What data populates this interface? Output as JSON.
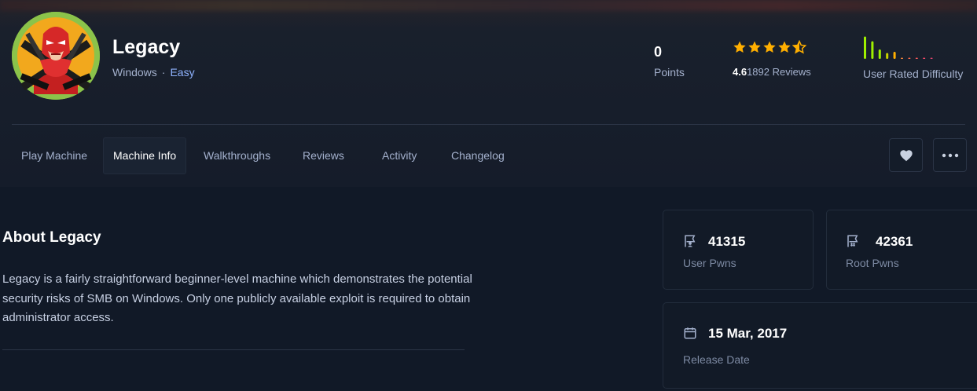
{
  "machine": {
    "name": "Legacy",
    "os": "Windows",
    "separator": "·",
    "difficulty": "Easy"
  },
  "stats": {
    "points_value": "0",
    "points_label": "Points",
    "rating_value": "4.6",
    "reviews_text": "1892 Reviews",
    "star_rating": 4.6,
    "difficulty_label": "User Rated Difficulty",
    "difficulty_bars": [
      0.95,
      0.75,
      0.4,
      0.25,
      0.3,
      0.05,
      0.05,
      0.05,
      0.05,
      0.05
    ]
  },
  "tabs": [
    {
      "label": "Play Machine"
    },
    {
      "label": "Machine Info"
    },
    {
      "label": "Walkthroughs"
    },
    {
      "label": "Reviews"
    },
    {
      "label": "Activity"
    },
    {
      "label": "Changelog"
    }
  ],
  "active_tab": "Machine Info",
  "actions": {
    "favorite_icon": "heart-icon",
    "more_icon": "more-horizontal-icon"
  },
  "about": {
    "title": "About Legacy",
    "text": "Legacy is a fairly straightforward beginner-level machine which demonstrates the potential security risks of SMB on Windows. Only one publicly available exploit is required to obtain administrator access."
  },
  "cards": {
    "user_pwns_value": "41315",
    "user_pwns_label": "User Pwns",
    "root_pwns_value": "42361",
    "root_pwns_label": "Root Pwns",
    "release_date_value": "15 Mar, 2017",
    "release_date_label": "Release Date"
  },
  "colors": {
    "background": "#111927",
    "star": "#ffaf00",
    "easy": "#8fb3ff",
    "accent_green": "#9fef00"
  }
}
